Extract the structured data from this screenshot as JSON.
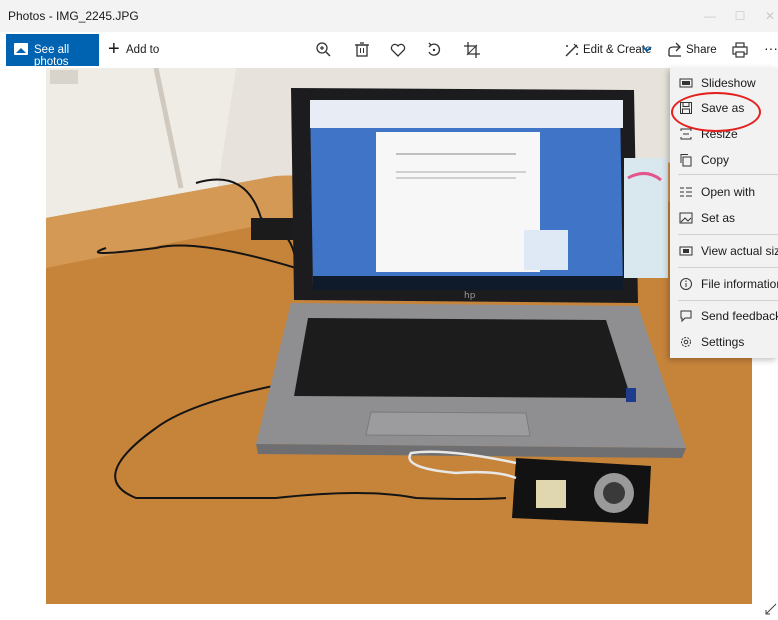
{
  "window": {
    "title": "Photos - IMG_2245.JPG",
    "controls": {
      "minimize": "—",
      "maximize": "☐",
      "close": "✕"
    }
  },
  "toolbar": {
    "see_all_photos": "See all photos",
    "add_to": "Add to",
    "icons": [
      "zoom-in-icon",
      "delete-icon",
      "favorite-icon",
      "rotate-icon",
      "crop-icon"
    ],
    "edit_create": "Edit & Create",
    "share": "Share",
    "more": "···"
  },
  "menu": {
    "items": [
      {
        "label": "Slideshow",
        "icon": "slideshow-icon"
      },
      {
        "label": "Save as",
        "icon": "save-icon"
      },
      {
        "label": "Resize",
        "icon": "resize-icon"
      },
      {
        "label": "Copy",
        "icon": "copy-icon"
      },
      {
        "label": "Open with",
        "icon": "open-with-icon"
      },
      {
        "label": "Set as",
        "icon": "set-as-icon"
      },
      {
        "label": "View actual size",
        "icon": "actual-size-icon"
      },
      {
        "label": "File information",
        "icon": "info-icon"
      },
      {
        "label": "Send feedback",
        "icon": "feedback-icon"
      },
      {
        "label": "Settings",
        "icon": "settings-icon"
      }
    ]
  },
  "photo": {
    "subject": "laptop-with-camera",
    "laptop_brand": "hp"
  },
  "colors": {
    "accent": "#0063b1",
    "highlight": "#e51e1e",
    "desk": "#c8843a",
    "wall": "#e9e6e0"
  }
}
